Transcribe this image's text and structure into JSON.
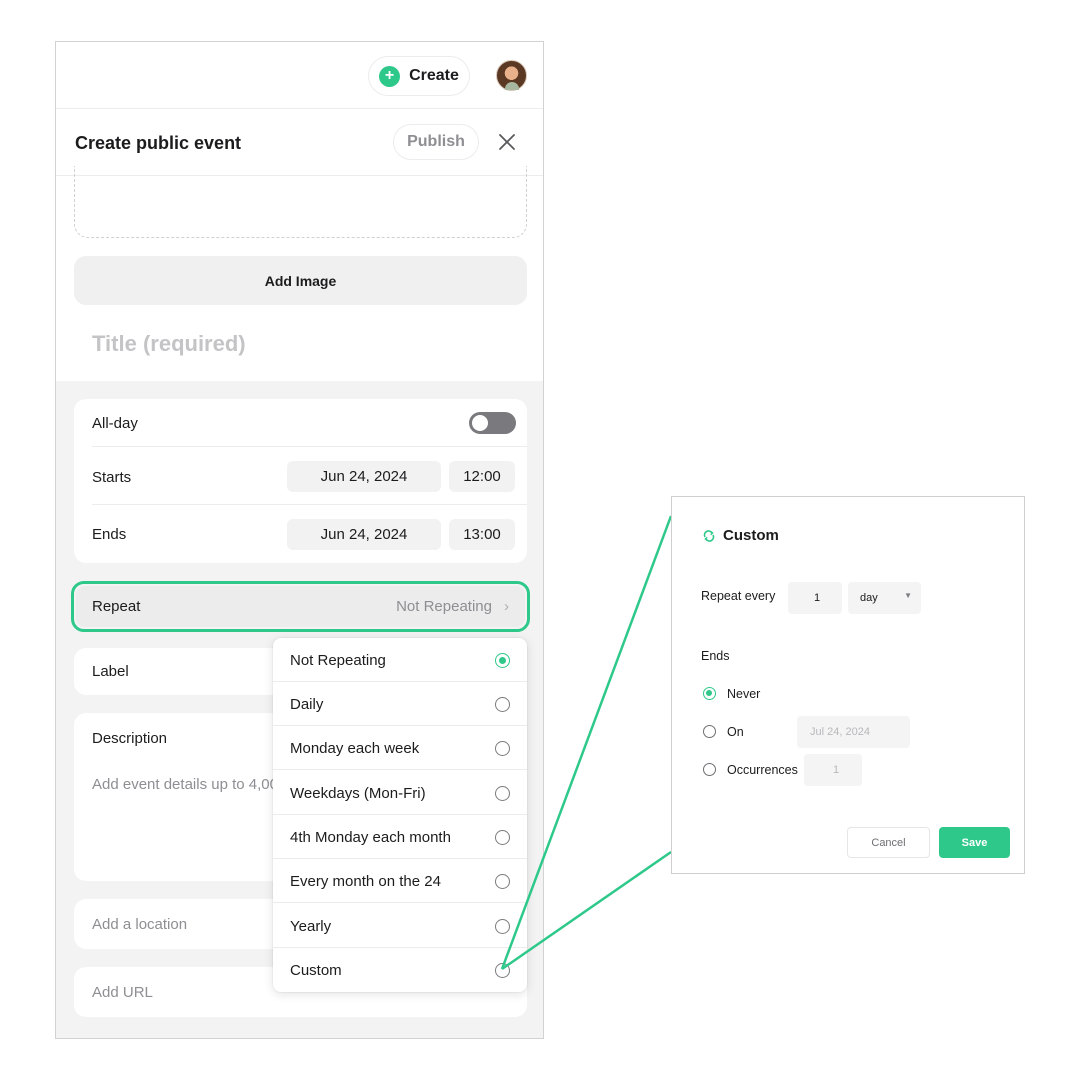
{
  "colors": {
    "accent": "#2ec98a",
    "muted_text": "#8e8e93"
  },
  "top_bar": {
    "create_label": "Create",
    "create_icon": "plus-icon",
    "avatar": "user-avatar"
  },
  "header": {
    "title": "Create public event",
    "publish_label": "Publish",
    "close_icon": "close-icon"
  },
  "media": {
    "add_image_label": "Add Image"
  },
  "form": {
    "title_placeholder": "Title (required)",
    "all_day_label": "All-day",
    "all_day_on": false,
    "starts_label": "Starts",
    "starts_date": "Jun 24, 2024",
    "starts_time": "12:00",
    "ends_label": "Ends",
    "ends_date": "Jun 24, 2024",
    "ends_time": "13:00",
    "repeat_label": "Repeat",
    "repeat_value": "Not Repeating",
    "label_label": "Label",
    "description_label": "Description",
    "description_placeholder": "Add event details up to 4,00",
    "location_placeholder": "Add a location",
    "url_placeholder": "Add URL"
  },
  "repeat_menu": {
    "items": [
      {
        "label": "Not Repeating",
        "selected": true
      },
      {
        "label": "Daily",
        "selected": false
      },
      {
        "label": "Monday each week",
        "selected": false
      },
      {
        "label": "Weekdays (Mon-Fri)",
        "selected": false
      },
      {
        "label": "4th Monday each month",
        "selected": false
      },
      {
        "label": "Every month on the 24",
        "selected": false
      },
      {
        "label": "Yearly",
        "selected": false
      },
      {
        "label": "Custom",
        "selected": false
      }
    ]
  },
  "custom_dialog": {
    "title": "Custom",
    "title_icon": "repeat-icon",
    "repeat_every_label": "Repeat every",
    "repeat_every_value": "1",
    "unit_value": "day",
    "ends_label": "Ends",
    "never_label": "Never",
    "on_label": "On",
    "on_date": "Jul 24, 2024",
    "occurrences_label": "Occurrences",
    "occurrences_value": "1",
    "selected_end": "Never",
    "cancel_label": "Cancel",
    "save_label": "Save"
  }
}
